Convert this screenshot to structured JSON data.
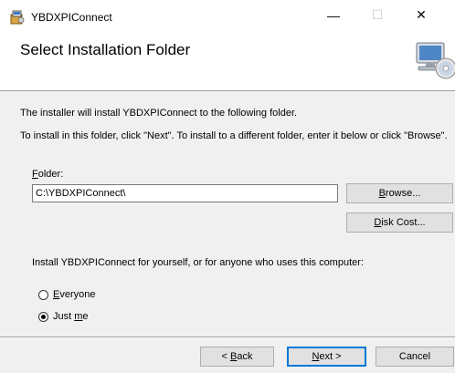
{
  "window": {
    "title": "YBDXPIConnect",
    "minimize_glyph": "—",
    "maximize_glyph": "☐",
    "close_glyph": "✕"
  },
  "banner": {
    "title": "Select Installation Folder",
    "image_icon": "computer-cd-icon"
  },
  "body": {
    "line1": "The installer will install YBDXPIConnect to the following folder.",
    "line2": "To install in this folder, click \"Next\". To install to a different folder, enter it below or click \"Browse\"."
  },
  "folder": {
    "label_accel": "F",
    "label_rest": "older:",
    "value": "C:\\YBDXPIConnect\\"
  },
  "buttons": {
    "browse_accel": "B",
    "browse_rest": "rowse...",
    "diskcost_accel": "D",
    "diskcost_rest": "isk Cost...",
    "back_pre": "< ",
    "back_accel": "B",
    "back_rest": "ack",
    "next_accel": "N",
    "next_rest": "ext >",
    "cancel": "Cancel"
  },
  "install_for": {
    "prompt": "Install YBDXPIConnect for yourself, or for anyone who uses this computer:",
    "options": [
      {
        "accel": "E",
        "rest": "veryone",
        "checked": false
      },
      {
        "pre": "Just ",
        "accel": "m",
        "rest": "e",
        "checked": true
      }
    ]
  },
  "colors": {
    "dialog_bg": "#f0f0f0",
    "banner_bg": "#ffffff",
    "default_button_border": "#0078d7"
  }
}
